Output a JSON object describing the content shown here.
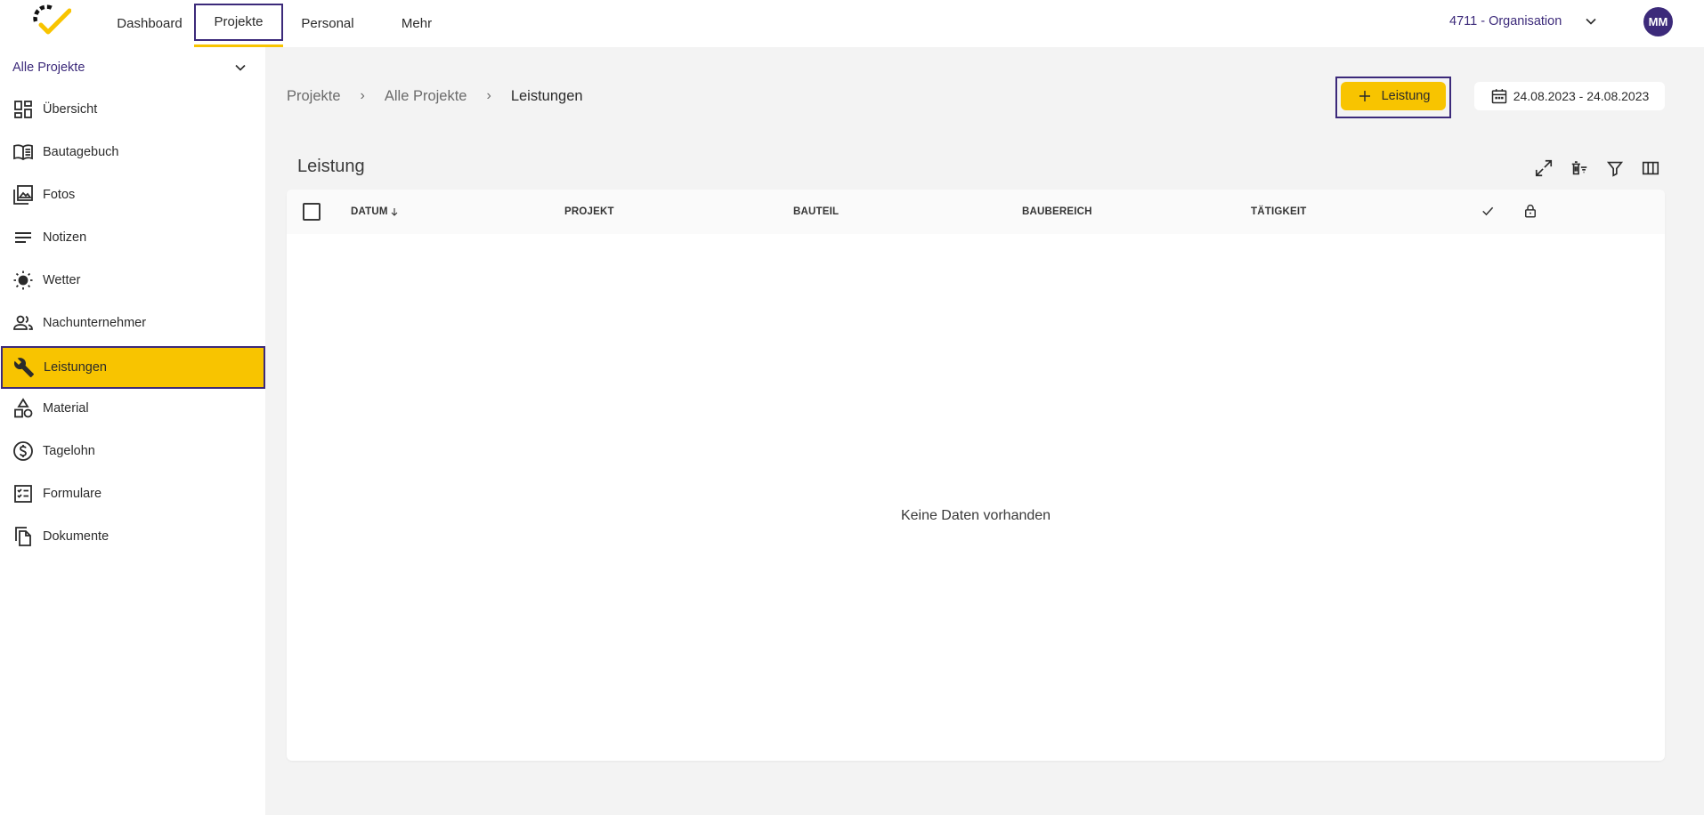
{
  "topbar": {
    "nav": [
      {
        "label": "Dashboard"
      },
      {
        "label": "Projekte"
      },
      {
        "label": "Personal"
      },
      {
        "label": "Mehr"
      }
    ],
    "organisation": "4711 - Organisation",
    "avatar_initials": "MM"
  },
  "sidebar": {
    "project_select": "Alle Projekte",
    "items": [
      {
        "label": "Übersicht",
        "icon": "dashboard-icon"
      },
      {
        "label": "Bautagebuch",
        "icon": "book-icon"
      },
      {
        "label": "Fotos",
        "icon": "photos-icon"
      },
      {
        "label": "Notizen",
        "icon": "notes-icon"
      },
      {
        "label": "Wetter",
        "icon": "sun-icon"
      },
      {
        "label": "Nachunternehmer",
        "icon": "people-icon"
      },
      {
        "label": "Leistungen",
        "icon": "wrench-icon"
      },
      {
        "label": "Material",
        "icon": "shapes-icon"
      },
      {
        "label": "Tagelohn",
        "icon": "dollar-icon"
      },
      {
        "label": "Formulare",
        "icon": "form-icon"
      },
      {
        "label": "Dokumente",
        "icon": "documents-icon"
      }
    ]
  },
  "main": {
    "breadcrumb": [
      "Projekte",
      "Alle Projekte",
      "Leistungen"
    ],
    "add_button": "Leistung",
    "date_range": "24.08.2023 - 24.08.2023",
    "table": {
      "title": "Leistung",
      "columns": [
        "DATUM",
        "PROJEKT",
        "BAUTEIL",
        "BAUBEREICH",
        "TÄTIGKEIT"
      ],
      "empty_text": "Keine Daten vorhanden"
    }
  },
  "colors": {
    "accent": "#f8c400",
    "brand": "#3c2a7a"
  }
}
